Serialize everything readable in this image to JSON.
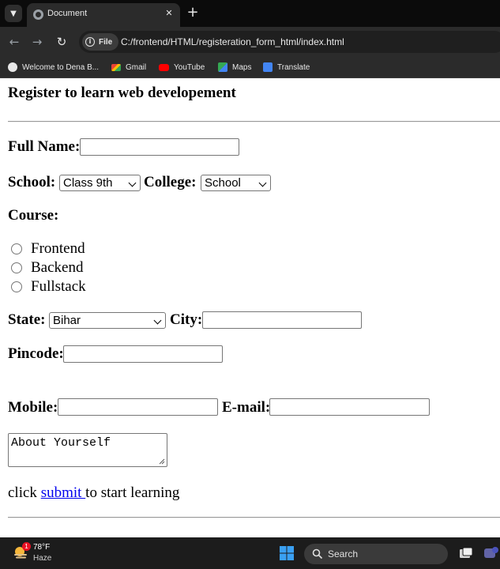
{
  "browser": {
    "tab_switcher_icon": "chevron-down-icon",
    "tab": {
      "title": "Document",
      "close_icon": "close-icon"
    },
    "new_tab_label": "+",
    "nav": {
      "back_icon": "arrow-left-icon",
      "forward_icon": "arrow-right-icon",
      "reload_icon": "reload-icon"
    },
    "address": {
      "chip_label": "File",
      "url": "C:/frontend/HTML/registeration_form_html/index.html"
    },
    "bookmarks": [
      {
        "label": "Welcome to Dena B...",
        "icon": "globe-icon"
      },
      {
        "label": "Gmail",
        "icon": "gmail-icon"
      },
      {
        "label": "YouTube",
        "icon": "youtube-icon"
      },
      {
        "label": "Maps",
        "icon": "maps-icon"
      },
      {
        "label": "Translate",
        "icon": "translate-icon"
      }
    ]
  },
  "form": {
    "title": "Register to learn web developement",
    "full_name": {
      "label": "Full Name:",
      "value": ""
    },
    "school": {
      "label": "School:",
      "selected": "Class 9th"
    },
    "college": {
      "label": "College:",
      "selected": "School"
    },
    "course": {
      "label": "Course:",
      "options": [
        "Frontend",
        "Backend",
        "Fullstack"
      ]
    },
    "state": {
      "label": "State:",
      "selected": "Bihar"
    },
    "city": {
      "label": "City:",
      "value": ""
    },
    "pincode": {
      "label": "Pincode:",
      "value": ""
    },
    "mobile": {
      "label": "Mobile:",
      "value": ""
    },
    "email": {
      "label": "E-mail:",
      "value": ""
    },
    "about": {
      "value": "About Yourself"
    },
    "footer": {
      "prefix": "click ",
      "link": "submit ",
      "suffix": "to start learning"
    }
  },
  "taskbar": {
    "weather": {
      "temp": "78°F",
      "condition": "Haze",
      "badge": "1"
    },
    "search_label": "Search",
    "colors": {
      "start": "#0078d4",
      "badge": "#e81123"
    }
  }
}
